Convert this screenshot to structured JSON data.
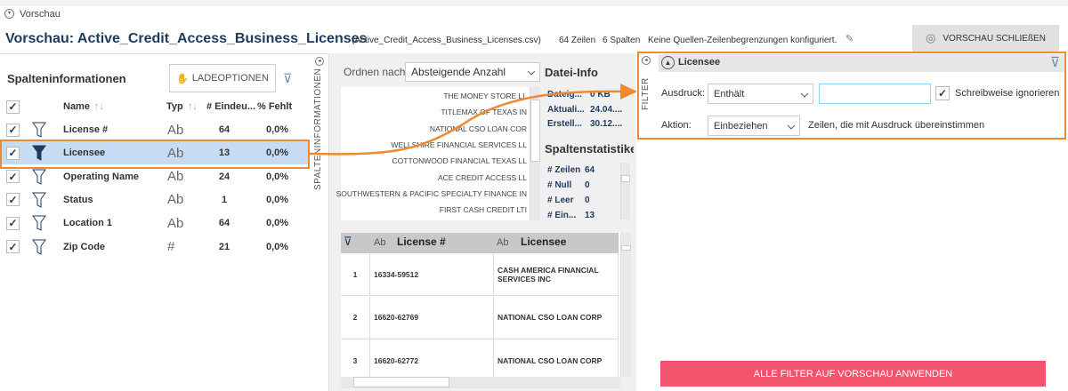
{
  "breadcrumb": "Vorschau",
  "title": "Vorschau: Active_Credit_Access_Business_Licenses",
  "filename": "(Active_Credit_Access_Business_Licenses.csv)",
  "rows_count": "64 Zeilen",
  "cols_count": "6 Spalten",
  "limit_note": "Keine Quellen-Zeilenbegrenzungen konfiguriert.",
  "close_preview": "VORSCHAU SCHLIEßEN",
  "left": {
    "heading": "Spalteninformationen",
    "load_options": "LADEOPTIONEN",
    "vertical": "SPALTENINFORMATIONEN",
    "headers": {
      "name": "Name",
      "type": "Typ",
      "unique": "# Eindeu...",
      "missing": "% Fehlt"
    },
    "rows": [
      {
        "name": "License #",
        "type": "Ab",
        "unique": "64",
        "missing": "0,0%"
      },
      {
        "name": "Licensee",
        "type": "Ab",
        "unique": "13",
        "missing": "0,0%"
      },
      {
        "name": "Operating Name",
        "type": "Ab",
        "unique": "24",
        "missing": "0,0%"
      },
      {
        "name": "Status",
        "type": "Ab",
        "unique": "1",
        "missing": "0,0%"
      },
      {
        "name": "Location 1",
        "type": "Ab",
        "unique": "64",
        "missing": "0,0%"
      },
      {
        "name": "Zip Code",
        "type": "#",
        "unique": "21",
        "missing": "0,0%"
      }
    ]
  },
  "middle": {
    "sort_label": "Ordnen nach",
    "sort_value": "Absteigende Anzahl",
    "values": [
      "THE MONEY STORE LL",
      "TITLEMAX OF TEXAS IN",
      "NATIONAL CSO LOAN COR",
      "WELLSHIRE FINANCIAL SERVICES LL",
      "COTTONWOOD FINANCIAL TEXAS LL",
      "ACE CREDIT ACCESS LL",
      "SOUTHWESTERN & PACIFIC SPECIALTY FINANCE IN",
      "FIRST CASH CREDIT LTI"
    ],
    "file_info_title": "Datei-Info",
    "file_info": [
      {
        "k": "Dateig...",
        "v": "0 KB"
      },
      {
        "k": "Aktuali...",
        "v": "24.04...."
      },
      {
        "k": "Erstell...",
        "v": "30.12...."
      }
    ],
    "stats_title": "Spaltenstatistike",
    "stats": [
      {
        "k": "# Zeilen",
        "v": "64"
      },
      {
        "k": "# Null",
        "v": "0"
      },
      {
        "k": "# Leer",
        "v": "0"
      },
      {
        "k": "# Ein...",
        "v": "13"
      }
    ],
    "table": {
      "type1": "Ab",
      "col1": "License #",
      "type2": "Ab",
      "col2": "Licensee",
      "rows": [
        {
          "n": "1",
          "license": "16334-59512",
          "licensee": "CASH AMERICA FINANCIAL SERVICES INC"
        },
        {
          "n": "2",
          "license": "16620-62769",
          "licensee": "NATIONAL CSO LOAN CORP"
        },
        {
          "n": "3",
          "license": "16620-62772",
          "licensee": "NATIONAL CSO LOAN CORP"
        }
      ]
    }
  },
  "filter": {
    "vertical": "FILTER",
    "column": "Licensee",
    "expr_label": "Ausdruck:",
    "expr_value": "Enthält",
    "text_value": "",
    "ignore_case": "Schreibweise ignorieren",
    "action_label": "Aktion:",
    "action_value": "Einbeziehen",
    "action_note": "Zeilen, die mit Ausdruck übereinstimmen",
    "apply": "ALLE FILTER AUF VORSCHAU ANWENDEN"
  },
  "colors": {
    "accent": "#f08a30",
    "apply": "#f2546e",
    "selected": "#c5dcf2",
    "title": "#1f3a5f"
  }
}
